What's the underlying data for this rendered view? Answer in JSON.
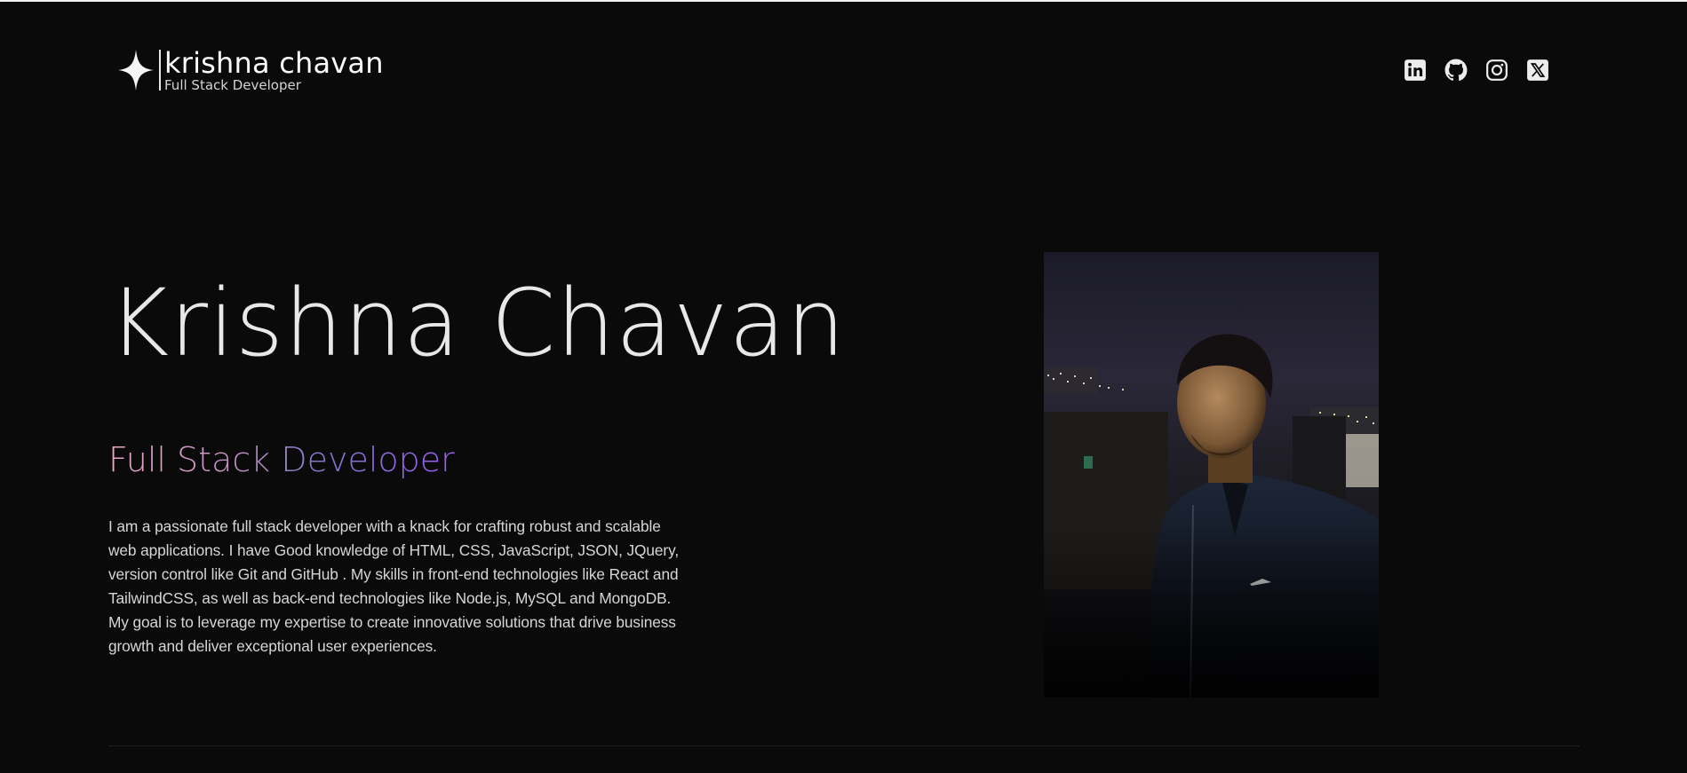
{
  "header": {
    "brand_name": "krishna chavan",
    "brand_role": "Full Stack Developer",
    "socials": [
      {
        "name": "linkedin",
        "icon": "linkedin-icon"
      },
      {
        "name": "github",
        "icon": "github-icon"
      },
      {
        "name": "instagram",
        "icon": "instagram-icon"
      },
      {
        "name": "x",
        "icon": "x-twitter-icon"
      }
    ]
  },
  "hero": {
    "name": "Krishna Chavan",
    "role": "Full Stack Developer",
    "bio": "I am a passionate full stack developer with a knack for crafting robust and scalable web applications. I have Good knowledge of HTML, CSS, JavaScript, JSON, JQuery, version control like Git and GitHub . My skills in front-end technologies like React and TailwindCSS, as well as back-end technologies like Node.js, MySQL and MongoDB. My goal is to leverage my expertise to create innovative solutions that drive business growth and deliver exceptional user experiences.",
    "photo_subject": "portrait-photo"
  },
  "colors": {
    "background": "#0a0a0a",
    "text": "#e5e5e5",
    "gradient_start": "#f0a8c8",
    "gradient_end": "#9b5cf0"
  }
}
